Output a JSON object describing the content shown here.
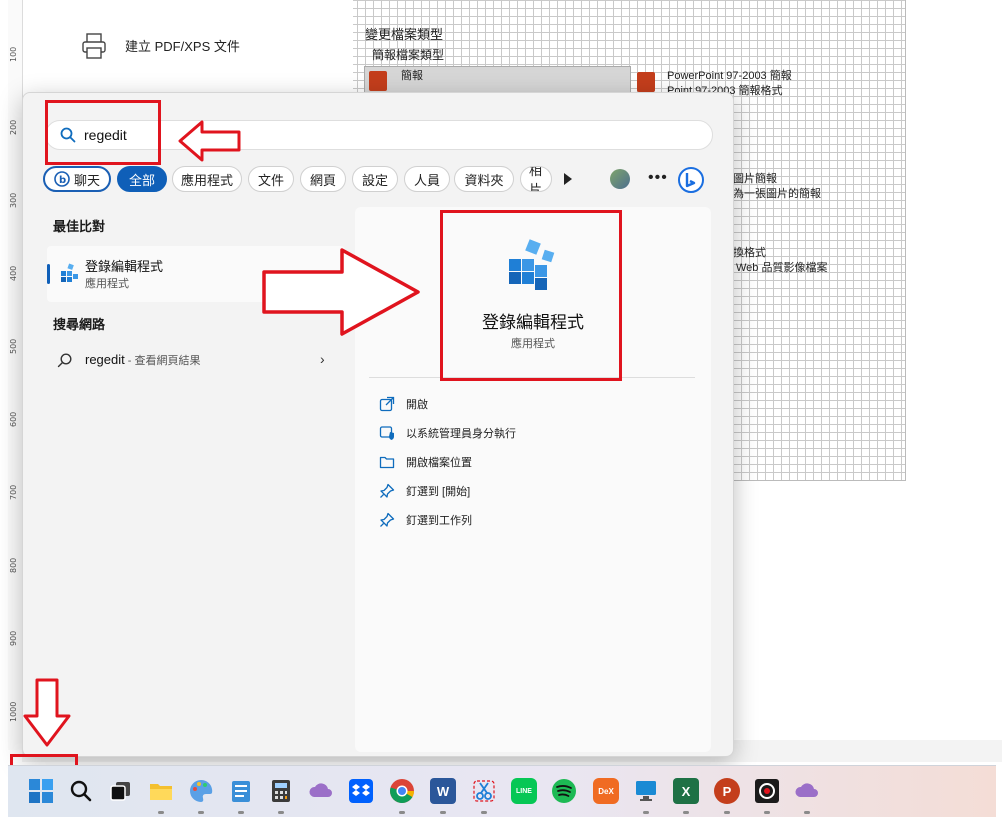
{
  "background": {
    "export_label": "建立 PDF/XPS 文件",
    "change_type_title": "變更檔案類型",
    "ppt_types_heading": "簡報檔案類型",
    "file_types": [
      {
        "title": "簡報",
        "sub": ""
      },
      {
        "title": "PowerPoint 97-2003 簡報",
        "sub": "Point 97-2003 簡報格式"
      },
      {
        "title": "圖片簡報",
        "sub": "為一張圖片的簡報"
      },
      {
        "title": "換格式",
        "sub": "Web 品質影像檔案"
      }
    ],
    "ruler_numbers": [
      "100",
      "200",
      "300",
      "400",
      "500",
      "600",
      "700",
      "800",
      "900",
      "1000"
    ]
  },
  "search": {
    "query": "regedit",
    "icon": "search-icon"
  },
  "filters": [
    {
      "label": "聊天",
      "icon": "bing-chat-icon"
    },
    {
      "label": "全部",
      "selected": true
    },
    {
      "label": "應用程式"
    },
    {
      "label": "文件"
    },
    {
      "label": "網頁"
    },
    {
      "label": "設定"
    },
    {
      "label": "人員"
    },
    {
      "label": "資料夾"
    },
    {
      "label": "相片"
    }
  ],
  "left_pane": {
    "best_match_heading": "最佳比對",
    "best_match": {
      "name": "登錄編輯程式",
      "type": "應用程式",
      "icon": "registry-editor-icon"
    },
    "web_heading": "搜尋網路",
    "web_result": {
      "query": "regedit",
      "suffix": " - 查看網頁結果"
    }
  },
  "detail": {
    "name": "登錄編輯程式",
    "type": "應用程式",
    "actions": [
      {
        "label": "開啟",
        "icon": "open-external-icon"
      },
      {
        "label": "以系統管理員身分執行",
        "icon": "shield-admin-icon"
      },
      {
        "label": "開啟檔案位置",
        "icon": "folder-icon"
      },
      {
        "label": "釘選到 [開始]",
        "icon": "pin-icon"
      },
      {
        "label": "釘選到工作列",
        "icon": "pin-icon"
      }
    ]
  },
  "taskbar": {
    "apps": [
      {
        "name": "start",
        "icon": "windows-logo-icon"
      },
      {
        "name": "search",
        "icon": "search-icon"
      },
      {
        "name": "task-view",
        "icon": "task-view-icon"
      },
      {
        "name": "file-explorer",
        "icon": "folder-icon"
      },
      {
        "name": "paint",
        "icon": "paint-palette-icon"
      },
      {
        "name": "notepad",
        "icon": "notepad-icon"
      },
      {
        "name": "calculator",
        "icon": "calculator-icon"
      },
      {
        "name": "cloud-app",
        "icon": "cloud-icon"
      },
      {
        "name": "dropbox",
        "icon": "dropbox-icon"
      },
      {
        "name": "chrome",
        "icon": "chrome-icon"
      },
      {
        "name": "word",
        "icon": "word-icon",
        "text": "W"
      },
      {
        "name": "snipping-tool",
        "icon": "scissors-icon"
      },
      {
        "name": "line",
        "icon": "line-icon",
        "text": "LINE"
      },
      {
        "name": "spotify",
        "icon": "spotify-icon"
      },
      {
        "name": "dex",
        "icon": "dex-icon",
        "text": "DeX"
      },
      {
        "name": "screen-app",
        "icon": "monitor-icon"
      },
      {
        "name": "excel",
        "icon": "excel-icon",
        "text": "X"
      },
      {
        "name": "powerpoint",
        "icon": "powerpoint-icon",
        "text": "P"
      },
      {
        "name": "obs",
        "icon": "record-icon"
      },
      {
        "name": "cloud-app-2",
        "icon": "cloud-icon"
      }
    ]
  },
  "colors": {
    "accent": "#0f5fb8",
    "annotation_red": "#e0141e",
    "registry_blue": "#1f7fd6"
  }
}
